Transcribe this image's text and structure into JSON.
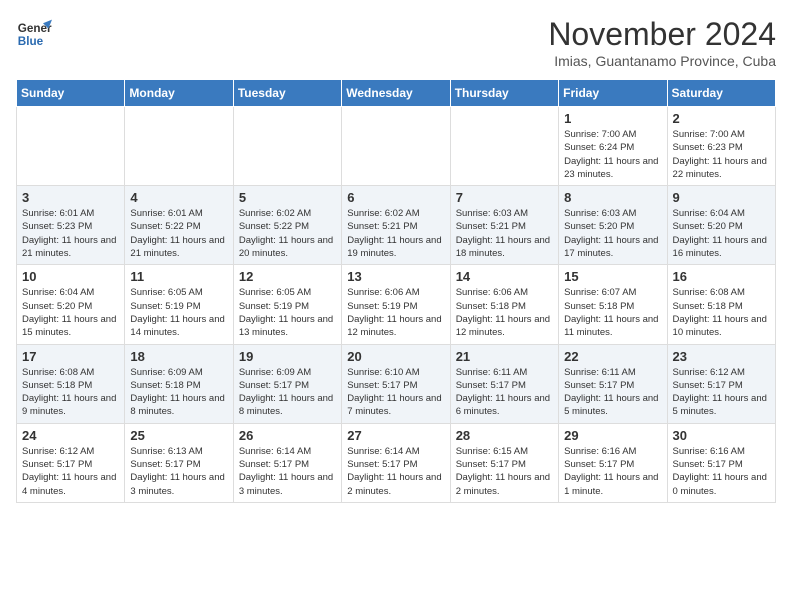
{
  "header": {
    "logo_line1": "General",
    "logo_line2": "Blue",
    "month": "November 2024",
    "location": "Imias, Guantanamo Province, Cuba"
  },
  "weekdays": [
    "Sunday",
    "Monday",
    "Tuesday",
    "Wednesday",
    "Thursday",
    "Friday",
    "Saturday"
  ],
  "weeks": [
    [
      {
        "day": "",
        "info": ""
      },
      {
        "day": "",
        "info": ""
      },
      {
        "day": "",
        "info": ""
      },
      {
        "day": "",
        "info": ""
      },
      {
        "day": "",
        "info": ""
      },
      {
        "day": "1",
        "info": "Sunrise: 7:00 AM\nSunset: 6:24 PM\nDaylight: 11 hours\nand 23 minutes."
      },
      {
        "day": "2",
        "info": "Sunrise: 7:00 AM\nSunset: 6:23 PM\nDaylight: 11 hours\nand 22 minutes."
      }
    ],
    [
      {
        "day": "3",
        "info": "Sunrise: 6:01 AM\nSunset: 5:23 PM\nDaylight: 11 hours\nand 21 minutes."
      },
      {
        "day": "4",
        "info": "Sunrise: 6:01 AM\nSunset: 5:22 PM\nDaylight: 11 hours\nand 21 minutes."
      },
      {
        "day": "5",
        "info": "Sunrise: 6:02 AM\nSunset: 5:22 PM\nDaylight: 11 hours\nand 20 minutes."
      },
      {
        "day": "6",
        "info": "Sunrise: 6:02 AM\nSunset: 5:21 PM\nDaylight: 11 hours\nand 19 minutes."
      },
      {
        "day": "7",
        "info": "Sunrise: 6:03 AM\nSunset: 5:21 PM\nDaylight: 11 hours\nand 18 minutes."
      },
      {
        "day": "8",
        "info": "Sunrise: 6:03 AM\nSunset: 5:20 PM\nDaylight: 11 hours\nand 17 minutes."
      },
      {
        "day": "9",
        "info": "Sunrise: 6:04 AM\nSunset: 5:20 PM\nDaylight: 11 hours\nand 16 minutes."
      }
    ],
    [
      {
        "day": "10",
        "info": "Sunrise: 6:04 AM\nSunset: 5:20 PM\nDaylight: 11 hours\nand 15 minutes."
      },
      {
        "day": "11",
        "info": "Sunrise: 6:05 AM\nSunset: 5:19 PM\nDaylight: 11 hours\nand 14 minutes."
      },
      {
        "day": "12",
        "info": "Sunrise: 6:05 AM\nSunset: 5:19 PM\nDaylight: 11 hours\nand 13 minutes."
      },
      {
        "day": "13",
        "info": "Sunrise: 6:06 AM\nSunset: 5:19 PM\nDaylight: 11 hours\nand 12 minutes."
      },
      {
        "day": "14",
        "info": "Sunrise: 6:06 AM\nSunset: 5:18 PM\nDaylight: 11 hours\nand 12 minutes."
      },
      {
        "day": "15",
        "info": "Sunrise: 6:07 AM\nSunset: 5:18 PM\nDaylight: 11 hours\nand 11 minutes."
      },
      {
        "day": "16",
        "info": "Sunrise: 6:08 AM\nSunset: 5:18 PM\nDaylight: 11 hours\nand 10 minutes."
      }
    ],
    [
      {
        "day": "17",
        "info": "Sunrise: 6:08 AM\nSunset: 5:18 PM\nDaylight: 11 hours\nand 9 minutes."
      },
      {
        "day": "18",
        "info": "Sunrise: 6:09 AM\nSunset: 5:18 PM\nDaylight: 11 hours\nand 8 minutes."
      },
      {
        "day": "19",
        "info": "Sunrise: 6:09 AM\nSunset: 5:17 PM\nDaylight: 11 hours\nand 8 minutes."
      },
      {
        "day": "20",
        "info": "Sunrise: 6:10 AM\nSunset: 5:17 PM\nDaylight: 11 hours\nand 7 minutes."
      },
      {
        "day": "21",
        "info": "Sunrise: 6:11 AM\nSunset: 5:17 PM\nDaylight: 11 hours\nand 6 minutes."
      },
      {
        "day": "22",
        "info": "Sunrise: 6:11 AM\nSunset: 5:17 PM\nDaylight: 11 hours\nand 5 minutes."
      },
      {
        "day": "23",
        "info": "Sunrise: 6:12 AM\nSunset: 5:17 PM\nDaylight: 11 hours\nand 5 minutes."
      }
    ],
    [
      {
        "day": "24",
        "info": "Sunrise: 6:12 AM\nSunset: 5:17 PM\nDaylight: 11 hours\nand 4 minutes."
      },
      {
        "day": "25",
        "info": "Sunrise: 6:13 AM\nSunset: 5:17 PM\nDaylight: 11 hours\nand 3 minutes."
      },
      {
        "day": "26",
        "info": "Sunrise: 6:14 AM\nSunset: 5:17 PM\nDaylight: 11 hours\nand 3 minutes."
      },
      {
        "day": "27",
        "info": "Sunrise: 6:14 AM\nSunset: 5:17 PM\nDaylight: 11 hours\nand 2 minutes."
      },
      {
        "day": "28",
        "info": "Sunrise: 6:15 AM\nSunset: 5:17 PM\nDaylight: 11 hours\nand 2 minutes."
      },
      {
        "day": "29",
        "info": "Sunrise: 6:16 AM\nSunset: 5:17 PM\nDaylight: 11 hours\nand 1 minute."
      },
      {
        "day": "30",
        "info": "Sunrise: 6:16 AM\nSunset: 5:17 PM\nDaylight: 11 hours\nand 0 minutes."
      }
    ]
  ]
}
